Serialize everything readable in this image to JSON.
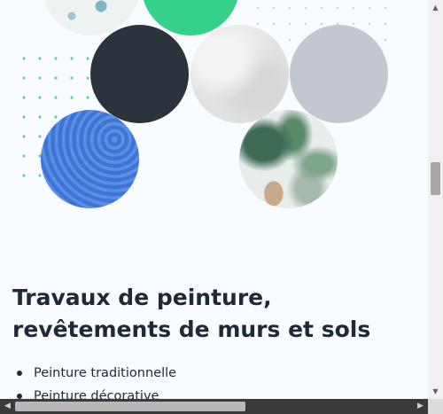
{
  "section": {
    "title": "Travaux de peinture, revêtements de murs et sols",
    "items": [
      "Peinture traditionnelle",
      "Peinture décorative"
    ]
  },
  "images": [
    "wallpaper-pattern-swatch",
    "green-color-swatch",
    "dark-color-swatch",
    "marble-texture-swatch",
    "grey-color-swatch",
    "blue-paint-texture-swatch",
    "tropical-wallpaper-room-swatch"
  ],
  "colors": {
    "background": "#f8fbff",
    "accent_green": "#34d188",
    "dark": "#2b333d",
    "grey": "#c3c7d0",
    "blue": "#4a7fdd",
    "text": "#1f2a37"
  },
  "scrollbars": {
    "up": "▲",
    "down": "▼",
    "left": "◀",
    "right": "▶"
  }
}
